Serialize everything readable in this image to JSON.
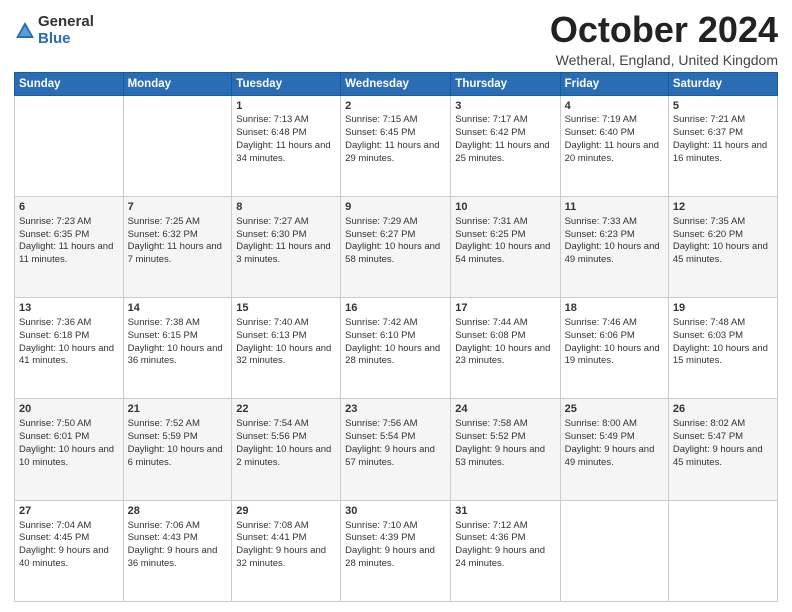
{
  "logo": {
    "general": "General",
    "blue": "Blue"
  },
  "title": "October 2024",
  "location": "Wetheral, England, United Kingdom",
  "days_header": [
    "Sunday",
    "Monday",
    "Tuesday",
    "Wednesday",
    "Thursday",
    "Friday",
    "Saturday"
  ],
  "weeks": [
    [
      {
        "day": "",
        "sunrise": "",
        "sunset": "",
        "daylight": ""
      },
      {
        "day": "",
        "sunrise": "",
        "sunset": "",
        "daylight": ""
      },
      {
        "day": "1",
        "sunrise": "Sunrise: 7:13 AM",
        "sunset": "Sunset: 6:48 PM",
        "daylight": "Daylight: 11 hours and 34 minutes."
      },
      {
        "day": "2",
        "sunrise": "Sunrise: 7:15 AM",
        "sunset": "Sunset: 6:45 PM",
        "daylight": "Daylight: 11 hours and 29 minutes."
      },
      {
        "day": "3",
        "sunrise": "Sunrise: 7:17 AM",
        "sunset": "Sunset: 6:42 PM",
        "daylight": "Daylight: 11 hours and 25 minutes."
      },
      {
        "day": "4",
        "sunrise": "Sunrise: 7:19 AM",
        "sunset": "Sunset: 6:40 PM",
        "daylight": "Daylight: 11 hours and 20 minutes."
      },
      {
        "day": "5",
        "sunrise": "Sunrise: 7:21 AM",
        "sunset": "Sunset: 6:37 PM",
        "daylight": "Daylight: 11 hours and 16 minutes."
      }
    ],
    [
      {
        "day": "6",
        "sunrise": "Sunrise: 7:23 AM",
        "sunset": "Sunset: 6:35 PM",
        "daylight": "Daylight: 11 hours and 11 minutes."
      },
      {
        "day": "7",
        "sunrise": "Sunrise: 7:25 AM",
        "sunset": "Sunset: 6:32 PM",
        "daylight": "Daylight: 11 hours and 7 minutes."
      },
      {
        "day": "8",
        "sunrise": "Sunrise: 7:27 AM",
        "sunset": "Sunset: 6:30 PM",
        "daylight": "Daylight: 11 hours and 3 minutes."
      },
      {
        "day": "9",
        "sunrise": "Sunrise: 7:29 AM",
        "sunset": "Sunset: 6:27 PM",
        "daylight": "Daylight: 10 hours and 58 minutes."
      },
      {
        "day": "10",
        "sunrise": "Sunrise: 7:31 AM",
        "sunset": "Sunset: 6:25 PM",
        "daylight": "Daylight: 10 hours and 54 minutes."
      },
      {
        "day": "11",
        "sunrise": "Sunrise: 7:33 AM",
        "sunset": "Sunset: 6:23 PM",
        "daylight": "Daylight: 10 hours and 49 minutes."
      },
      {
        "day": "12",
        "sunrise": "Sunrise: 7:35 AM",
        "sunset": "Sunset: 6:20 PM",
        "daylight": "Daylight: 10 hours and 45 minutes."
      }
    ],
    [
      {
        "day": "13",
        "sunrise": "Sunrise: 7:36 AM",
        "sunset": "Sunset: 6:18 PM",
        "daylight": "Daylight: 10 hours and 41 minutes."
      },
      {
        "day": "14",
        "sunrise": "Sunrise: 7:38 AM",
        "sunset": "Sunset: 6:15 PM",
        "daylight": "Daylight: 10 hours and 36 minutes."
      },
      {
        "day": "15",
        "sunrise": "Sunrise: 7:40 AM",
        "sunset": "Sunset: 6:13 PM",
        "daylight": "Daylight: 10 hours and 32 minutes."
      },
      {
        "day": "16",
        "sunrise": "Sunrise: 7:42 AM",
        "sunset": "Sunset: 6:10 PM",
        "daylight": "Daylight: 10 hours and 28 minutes."
      },
      {
        "day": "17",
        "sunrise": "Sunrise: 7:44 AM",
        "sunset": "Sunset: 6:08 PM",
        "daylight": "Daylight: 10 hours and 23 minutes."
      },
      {
        "day": "18",
        "sunrise": "Sunrise: 7:46 AM",
        "sunset": "Sunset: 6:06 PM",
        "daylight": "Daylight: 10 hours and 19 minutes."
      },
      {
        "day": "19",
        "sunrise": "Sunrise: 7:48 AM",
        "sunset": "Sunset: 6:03 PM",
        "daylight": "Daylight: 10 hours and 15 minutes."
      }
    ],
    [
      {
        "day": "20",
        "sunrise": "Sunrise: 7:50 AM",
        "sunset": "Sunset: 6:01 PM",
        "daylight": "Daylight: 10 hours and 10 minutes."
      },
      {
        "day": "21",
        "sunrise": "Sunrise: 7:52 AM",
        "sunset": "Sunset: 5:59 PM",
        "daylight": "Daylight: 10 hours and 6 minutes."
      },
      {
        "day": "22",
        "sunrise": "Sunrise: 7:54 AM",
        "sunset": "Sunset: 5:56 PM",
        "daylight": "Daylight: 10 hours and 2 minutes."
      },
      {
        "day": "23",
        "sunrise": "Sunrise: 7:56 AM",
        "sunset": "Sunset: 5:54 PM",
        "daylight": "Daylight: 9 hours and 57 minutes."
      },
      {
        "day": "24",
        "sunrise": "Sunrise: 7:58 AM",
        "sunset": "Sunset: 5:52 PM",
        "daylight": "Daylight: 9 hours and 53 minutes."
      },
      {
        "day": "25",
        "sunrise": "Sunrise: 8:00 AM",
        "sunset": "Sunset: 5:49 PM",
        "daylight": "Daylight: 9 hours and 49 minutes."
      },
      {
        "day": "26",
        "sunrise": "Sunrise: 8:02 AM",
        "sunset": "Sunset: 5:47 PM",
        "daylight": "Daylight: 9 hours and 45 minutes."
      }
    ],
    [
      {
        "day": "27",
        "sunrise": "Sunrise: 7:04 AM",
        "sunset": "Sunset: 4:45 PM",
        "daylight": "Daylight: 9 hours and 40 minutes."
      },
      {
        "day": "28",
        "sunrise": "Sunrise: 7:06 AM",
        "sunset": "Sunset: 4:43 PM",
        "daylight": "Daylight: 9 hours and 36 minutes."
      },
      {
        "day": "29",
        "sunrise": "Sunrise: 7:08 AM",
        "sunset": "Sunset: 4:41 PM",
        "daylight": "Daylight: 9 hours and 32 minutes."
      },
      {
        "day": "30",
        "sunrise": "Sunrise: 7:10 AM",
        "sunset": "Sunset: 4:39 PM",
        "daylight": "Daylight: 9 hours and 28 minutes."
      },
      {
        "day": "31",
        "sunrise": "Sunrise: 7:12 AM",
        "sunset": "Sunset: 4:36 PM",
        "daylight": "Daylight: 9 hours and 24 minutes."
      },
      {
        "day": "",
        "sunrise": "",
        "sunset": "",
        "daylight": ""
      },
      {
        "day": "",
        "sunrise": "",
        "sunset": "",
        "daylight": ""
      }
    ]
  ]
}
